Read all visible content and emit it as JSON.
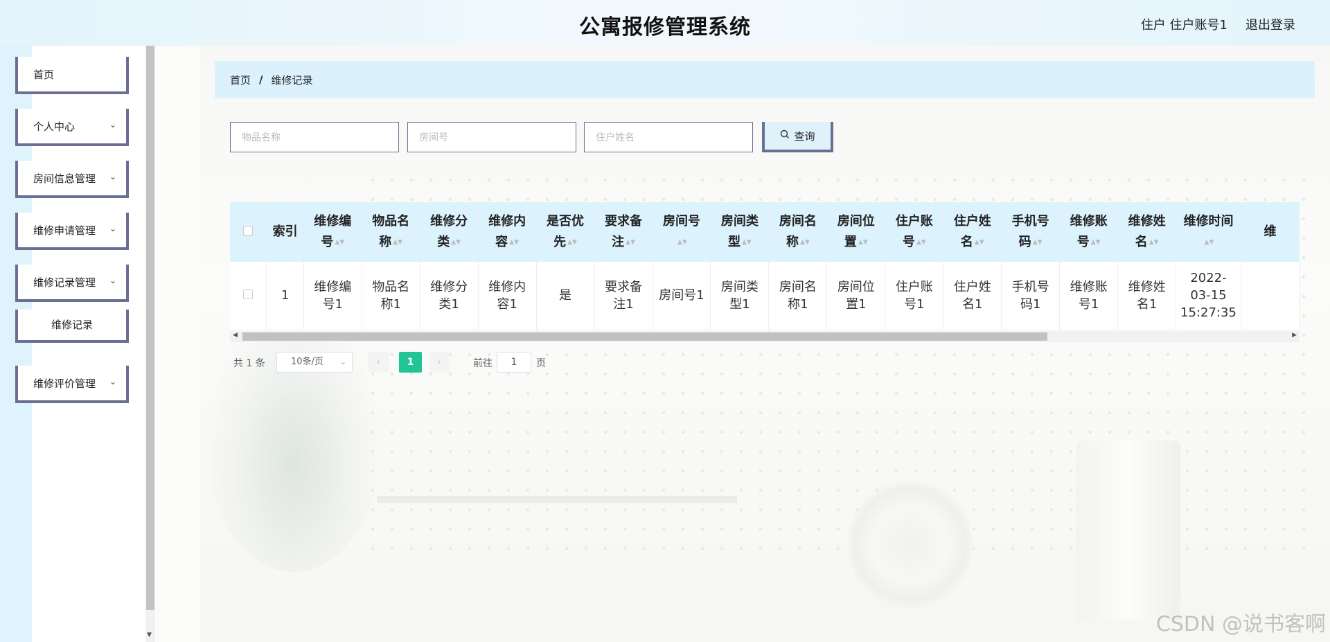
{
  "header": {
    "title": "公寓报修管理系统",
    "user_info": "住户 住户账号1",
    "logout_label": "退出登录"
  },
  "sidebar": {
    "items": [
      {
        "label": "首页"
      },
      {
        "label": "个人中心"
      },
      {
        "label": "房间信息管理"
      },
      {
        "label": "维修申请管理"
      },
      {
        "label": "维修记录管理"
      },
      {
        "label": "维修记录"
      },
      {
        "label": "维修评价管理"
      }
    ]
  },
  "breadcrumb": {
    "home": "首页",
    "separator": "/",
    "current": "维修记录"
  },
  "search": {
    "item_name_placeholder": "物品名称",
    "room_no_placeholder": "房间号",
    "resident_name_placeholder": "住户姓名",
    "query_label": "查询"
  },
  "table": {
    "headers": [
      "索引",
      "维修编号",
      "物品名称",
      "维修分类",
      "维修内容",
      "是否优先",
      "要求备注",
      "房间号",
      "房间类型",
      "房间名称",
      "房间位置",
      "住户账号",
      "住户姓名",
      "手机号码",
      "维修账号",
      "维修姓名",
      "维修时间",
      "维"
    ],
    "rows": [
      [
        "1",
        "维修编号1",
        "物品名称1",
        "维修分类1",
        "维修内容1",
        "是",
        "要求备注1",
        "房间号1",
        "房间类型1",
        "房间名称1",
        "房间位置1",
        "住户账号1",
        "住户姓名1",
        "手机号码1",
        "维修账号1",
        "维修姓名1",
        "2022-03-15 15:27:35",
        ""
      ]
    ]
  },
  "pagination": {
    "total": "共 1 条",
    "page_size": "10条/页",
    "current_page": "1",
    "goto_label": "前往",
    "goto_value": "1",
    "page_suffix": "页"
  },
  "watermark": "CSDN @说书客啊",
  "colors": {
    "header_bg": "#e3f4fc",
    "accent_border": "#6b6f94",
    "table_header_bg": "#dcf2fd",
    "page_active": "#21c494"
  }
}
